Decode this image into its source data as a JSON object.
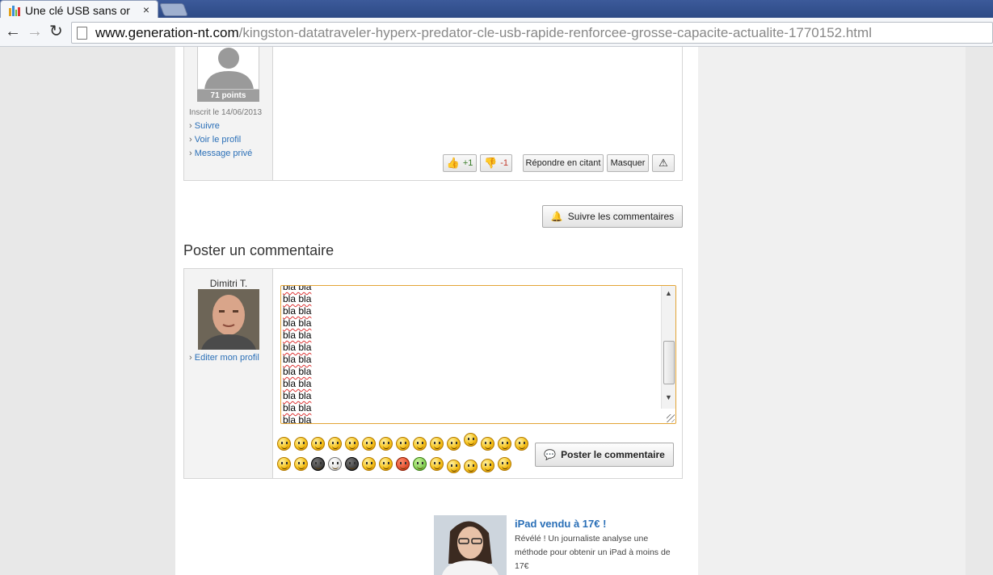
{
  "browser": {
    "tab_title": "Une clé USB sans or",
    "tab_close": "×",
    "url_host": "www.generation-nt.com",
    "url_path": "/kingston-datatraveler-hyperx-predator-cle-usb-rapide-renforcee-grosse-capacite-actualite-1770152.html"
  },
  "comment": {
    "points": "71 points",
    "inscrit": "Inscrit le 14/06/2013",
    "links": [
      "Suivre",
      "Voir le profil",
      "Message privé"
    ],
    "vote_up": "+1",
    "vote_down": "-1",
    "reply_quote": "Répondre en citant",
    "hide": "Masquer"
  },
  "follow_comments": "Suivre les commentaires",
  "post_section": {
    "title": "Poster un commentaire",
    "username": "Dimitri T.",
    "edit_profile": "Editer mon profil",
    "text_lines": [
      "bla bla",
      "bla bla",
      "bla bla",
      "bla bla",
      "bla bla",
      "bla bla",
      "bla bla",
      "bla bla",
      "bla bla",
      "bla bla",
      "bla bla",
      "bla bla"
    ],
    "submit": "Poster le commentaire"
  },
  "ad": {
    "title": "iPad vendu à 17€ !",
    "text": "Révélé ! Un journaliste analyse une méthode pour obtenir un iPad à moins de 17€"
  },
  "colors": {
    "link": "#2a6fb7",
    "textarea_focus": "#e3a436"
  }
}
